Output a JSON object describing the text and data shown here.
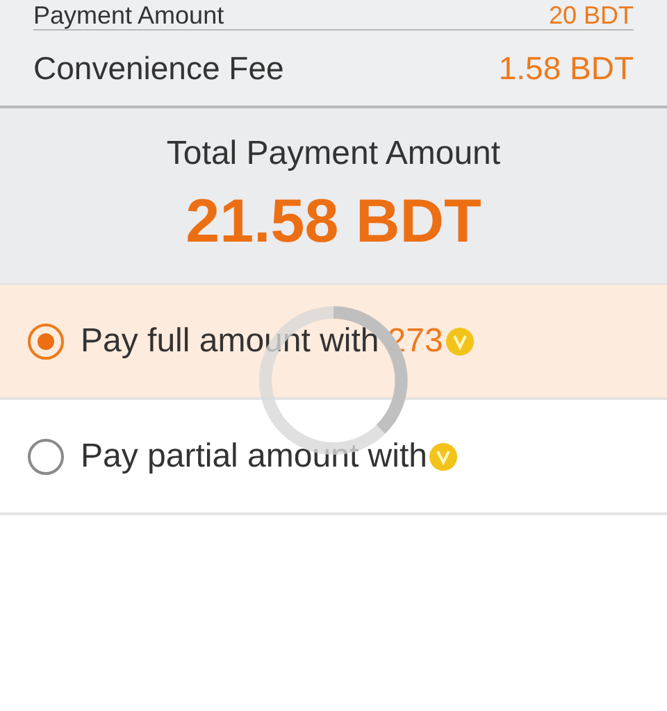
{
  "summary": {
    "rows": [
      {
        "label": "Payment Amount",
        "value": "20 BDT"
      },
      {
        "label": "Convenience Fee",
        "value": "1.58 BDT"
      }
    ]
  },
  "total": {
    "label": "Total Payment Amount",
    "value": "21.58 BDT"
  },
  "options": [
    {
      "label": "Pay full amount with",
      "amount": "273",
      "selected": true
    },
    {
      "label": "Pay partial amount with",
      "selected": false
    }
  ],
  "loading": true
}
